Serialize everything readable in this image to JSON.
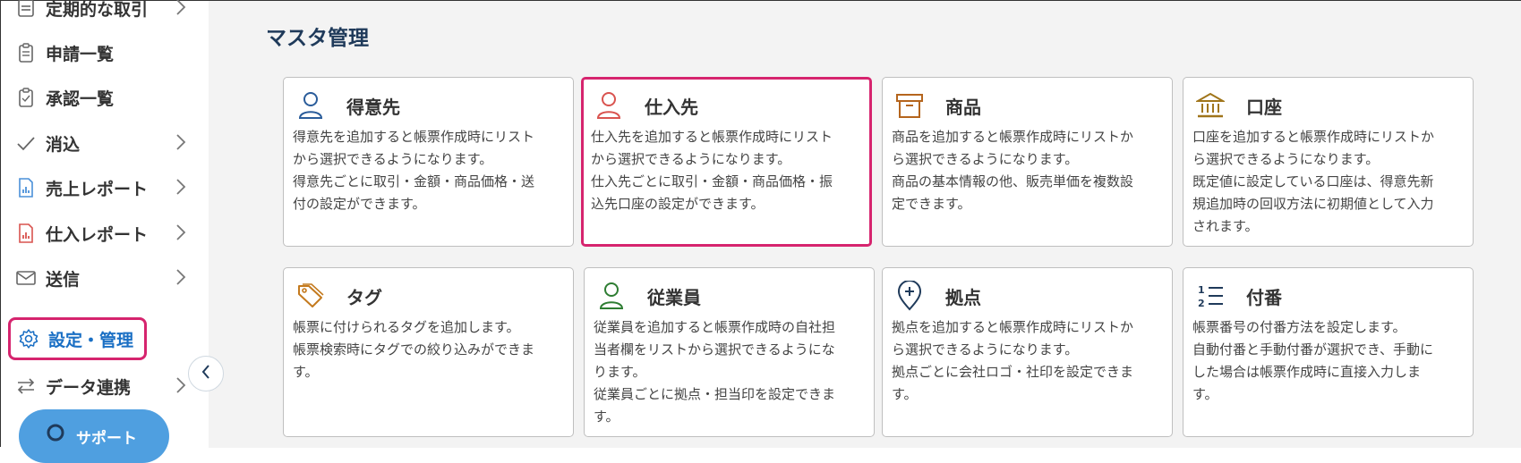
{
  "sidebar": {
    "items": [
      {
        "label": "定期的な取引",
        "icon": "recurring-icon",
        "has_chevron": true
      },
      {
        "label": "申請一覧",
        "icon": "clipboard-icon",
        "has_chevron": false
      },
      {
        "label": "承認一覧",
        "icon": "clipboard-check-icon",
        "has_chevron": false
      },
      {
        "label": "消込",
        "icon": "check-icon",
        "has_chevron": true
      },
      {
        "label": "売上レポート",
        "icon": "sales-report-icon",
        "has_chevron": true
      },
      {
        "label": "仕入レポート",
        "icon": "purchase-report-icon",
        "has_chevron": true
      },
      {
        "label": "送信",
        "icon": "mail-icon",
        "has_chevron": true
      },
      {
        "label": "設定・管理",
        "icon": "gear-icon",
        "has_chevron": false,
        "active": true
      },
      {
        "label": "データ連携",
        "icon": "sync-arrows-icon",
        "has_chevron": true
      }
    ],
    "support_label": "サポート"
  },
  "main": {
    "title": "マスタ管理",
    "cards": [
      {
        "title": "得意先",
        "icon": "person-icon",
        "color": "#2a5c9a",
        "desc": "得意先を追加すると帳票作成時にリスト\nから選択できるようになります。\n得意先ごとに取引・金額・商品価格・送\n付の設定ができます。"
      },
      {
        "title": "仕入先",
        "icon": "person-icon",
        "color": "#d9534f",
        "highlight": true,
        "desc": "仕入先を追加すると帳票作成時にリスト\nから選択できるようになります。\n仕入先ごとに取引・金額・商品価格・振\n込先口座の設定ができます。"
      },
      {
        "title": "商品",
        "icon": "box-icon",
        "color": "#b5651d",
        "desc": "商品を追加すると帳票作成時にリストか\nら選択できるようになります。\n商品の基本情報の他、販売単価を複数設\n定できます。"
      },
      {
        "title": "口座",
        "icon": "bank-icon",
        "color": "#a0751a",
        "desc": "口座を追加すると帳票作成時にリストか\nら選択できるようになります。\n既定値に設定している口座は、得意先新\n規追加時の回収方法に初期値として入力\nされます。"
      },
      {
        "title": "タグ",
        "icon": "tag-icon",
        "color": "#c47a1e",
        "desc": "帳票に付けられるタグを追加します。\n帳票検索時にタグでの絞り込みができま\nす。"
      },
      {
        "title": "従業員",
        "icon": "person-icon",
        "color": "#2e7d32",
        "desc": "従業員を追加すると帳票作成時の自社担\n当者欄をリストから選択できるようにな\nります。\n従業員ごとに拠点・担当印を設定できま\nす。"
      },
      {
        "title": "拠点",
        "icon": "location-pin-icon",
        "color": "#1f3a5a",
        "desc": "拠点を追加すると帳票作成時にリストか\nら選択できるようになります。\n拠点ごとに会社ロゴ・社印を設定できま\nす。"
      },
      {
        "title": "付番",
        "icon": "numbered-list-icon",
        "color": "#1f3a5a",
        "desc": "帳票番号の付番方法を設定します。\n自動付番と手動付番が選択でき、手動に\nした場合は帳票作成時に直接入力しま\nす。"
      }
    ]
  },
  "colors": {
    "accent": "#d6246e",
    "link": "#1a6fc4",
    "support": "#4f9fe0"
  }
}
